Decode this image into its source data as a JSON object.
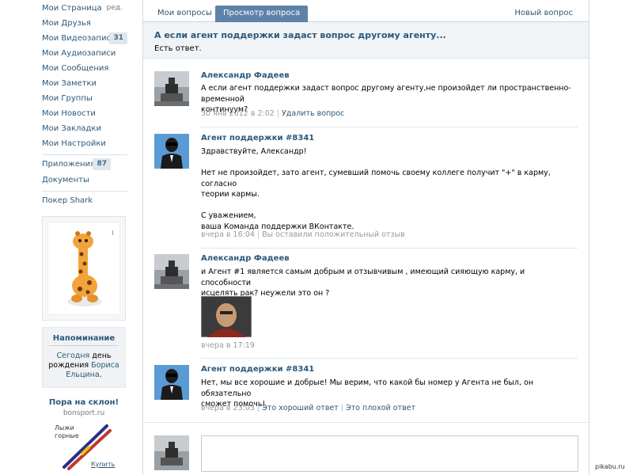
{
  "sidebar": {
    "items": [
      {
        "label": "Мои Страница",
        "extra": "ред."
      },
      {
        "label": "Мои Друзья"
      },
      {
        "label": "Мои Видеозаписи",
        "count": "31"
      },
      {
        "label": "Мои Аудиозаписи"
      },
      {
        "label": "Мои Сообщения"
      },
      {
        "label": "Мои Заметки"
      },
      {
        "label": "Мои Группы"
      },
      {
        "label": "Мои Новости"
      },
      {
        "label": "Мои Закладки"
      },
      {
        "label": "Мои Настройки"
      }
    ],
    "items2": [
      {
        "label": "Приложения",
        "count": "87"
      },
      {
        "label": "Документы"
      }
    ],
    "items3": [
      {
        "label": "Покер Shark"
      }
    ],
    "reminder": {
      "title": "Напоминание",
      "today": "Сегодня",
      "text1": " день рождения ",
      "name": "Бориса Ельцина",
      "end": "."
    },
    "ad2": {
      "title": "Пора на склон!",
      "domain": "bonsport.ru",
      "product": "Лыжи горные",
      "buy": "Купить"
    }
  },
  "tabs": {
    "my_questions": "Мои вопросы",
    "view_question": "Просмотр вопроса",
    "new_question": "Новый вопрос"
  },
  "question": {
    "title": "А если агент поддержки задаст вопрос другому агенту...",
    "status": "Есть ответ."
  },
  "posts": [
    {
      "author": "Александр Фадеев",
      "lines": [
        "А если агент поддержки задаст вопрос другому агенту,не произойдет ли пространственно-временной",
        "континуум?"
      ],
      "time": "30 янв 2012 в 2:02",
      "action": "Удалить вопрос"
    },
    {
      "author": "Агент поддержки #8341",
      "lines": [
        "Здравствуйте, Александр!",
        "",
        "Нет не произойдет, зато агент, сумевший помочь своему коллеге получит \"+\" в карму, согласно",
        "теории кармы.",
        "",
        "С уважением,",
        "ваша Команда поддержки ВКонтакте."
      ],
      "time": "вчера в 16:04",
      "action": "Вы оставили положительный отзыв"
    },
    {
      "author": "Александр Фадеев",
      "lines": [
        "и Агент #1 является самым добрым и отзывчивым , имеющий сияющую карму, и способности",
        "исцелять рак? неужели это он ?"
      ],
      "time": "вчера в 17:19"
    },
    {
      "author": "Агент поддержки #8341",
      "lines": [
        "Нет, мы все хорошие и добрые! Мы верим, что какой бы номер у Агента не был, он обязательно",
        "сможет помочь!"
      ],
      "time": "вчера в 23:03",
      "action": "Это хороший ответ",
      "action2": "Это плохой ответ"
    }
  ],
  "reply": {
    "placeholder": ""
  },
  "watermark": "pikabu.ru",
  "colors": {
    "link": "#2b587a",
    "active_tab": "#5e82a8",
    "header_bg": "#f1f4f7",
    "agent_avatar_bg": "#5b9bd5"
  }
}
